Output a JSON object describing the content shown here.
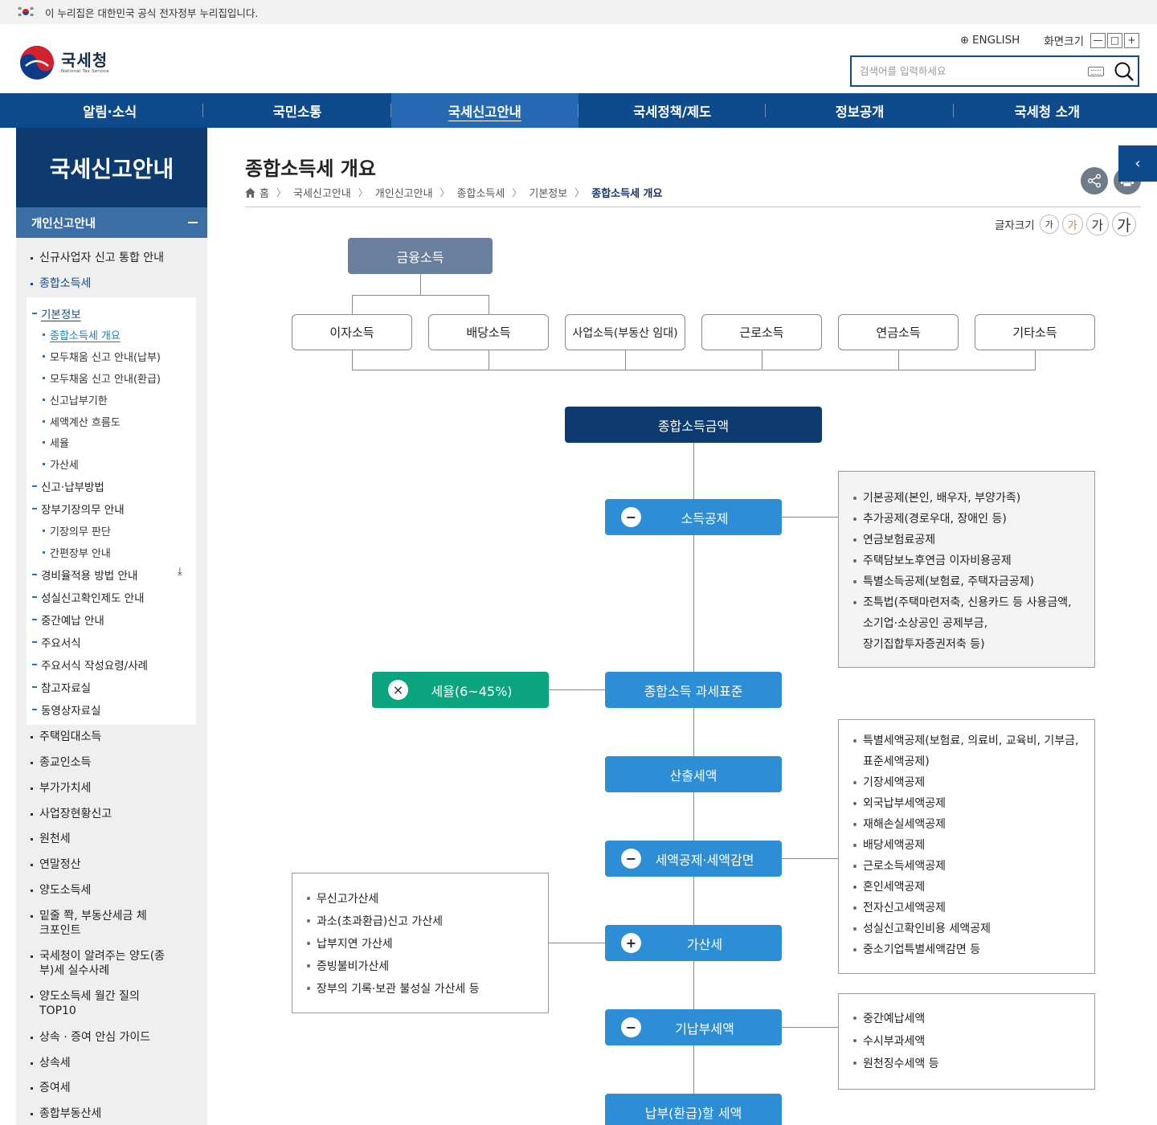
{
  "gov_banner": {
    "text": "이 누리집은 대한민국 공식 전자정부 누리집입니다."
  },
  "logo": {
    "name_kr": "국세청",
    "name_en": "National Tax Service"
  },
  "util": {
    "english": "ENGLISH",
    "screen_size": "화면크기",
    "zoom_out": "—",
    "zoom_reset": "□",
    "zoom_in": "+"
  },
  "search": {
    "placeholder": "검색어를 입력하세요"
  },
  "gnb": [
    {
      "label": "알림·소식"
    },
    {
      "label": "국민소통"
    },
    {
      "label": "국세신고안내"
    },
    {
      "label": "국세정책/제도"
    },
    {
      "label": "정보공개"
    },
    {
      "label": "국세청 소개"
    }
  ],
  "lnb": {
    "title": "국세신고안내",
    "section": "개인신고안내",
    "top_items": [
      "신규사업자 신고 통합 안내",
      "종합소득세"
    ],
    "sub_items": [
      {
        "label": "기본정보",
        "level": 2
      },
      {
        "label": "종합소득세 개요",
        "level": 3
      },
      {
        "label": "모두채움 신고 안내(납부)",
        "level": 3
      },
      {
        "label": "모두채움 신고 안내(환급)",
        "level": 3
      },
      {
        "label": "신고납부기한",
        "level": 3
      },
      {
        "label": "세액계산 흐름도",
        "level": 3
      },
      {
        "label": "세율",
        "level": 3
      },
      {
        "label": "가산세",
        "level": 3
      },
      {
        "label": "신고·납부방법",
        "level": 2
      },
      {
        "label": "장부기장의무 안내",
        "level": 2
      },
      {
        "label": "기장의무 판단",
        "level": 3
      },
      {
        "label": "간편장부 안내",
        "level": 3
      },
      {
        "label": "경비율적용 방법 안내",
        "level": 2
      },
      {
        "label": "성실신고확인제도 안내",
        "level": 2
      },
      {
        "label": "중간예납 안내",
        "level": 2
      },
      {
        "label": "주요서식",
        "level": 2
      },
      {
        "label": "주요서식 작성요령/사례",
        "level": 2
      },
      {
        "label": "참고자료실",
        "level": 2
      },
      {
        "label": "동영상자료실",
        "level": 2
      }
    ],
    "bottom_items": [
      "주택임대소득",
      "종교인소득",
      "부가가치세",
      "사업장현황신고",
      "원천세",
      "연말정산",
      "양도소득세",
      "밑줄 쫙, 부동산세금 체크포인트",
      "국세청이 알려주는 양도(종부)세 실수사례",
      "양도소득세 월간 질의 TOP10",
      "상속 · 증여 안심 가이드",
      "상속세",
      "증여세",
      "종합부동산세"
    ]
  },
  "content": {
    "title": "종합소득세 개요",
    "breadcrumb": [
      "홈",
      "국세신고안내",
      "개인신고안내",
      "종합소득세",
      "기본정보",
      "종합소득세 개요"
    ],
    "font_size_label": "글자크기",
    "font_size_glyph": "가"
  },
  "flow": {
    "source": "금융소득",
    "incomes": [
      "이자소득",
      "배당소득",
      "사업소득(부동산 임대)",
      "근로소득",
      "연금소득",
      "기타소득"
    ],
    "total": "종합소득금액",
    "steps": {
      "deduction": "소득공제",
      "tax_base": "종합소득 과세표준",
      "calc_tax": "산출세액",
      "credit": "세액공제·세액감면",
      "penalty": "가산세",
      "prepaid": "기납부세액",
      "final": "납부(환급)할 세액"
    },
    "rate": "세율(6~45%)",
    "deduction_list": [
      "기본공제(본인, 배우자, 부양가족)",
      "추가공제(경로우대, 장애인 등)",
      "연금보험료공제",
      "주택담보노후연금 이자비용공제",
      "특별소득공제(보험료, 주택자금공제)",
      "조특법(주택마련저축, 신용카드 등 사용금액,",
      "소기업·소상공인 공제부금,",
      "장기집합투자증권저축 등)"
    ],
    "credit_list": [
      "특별세액공제(보험료, 의료비, 교육비, 기부금,",
      "표준세액공제)",
      "기장세액공제",
      "외국납부세액공제",
      "재해손실세액공제",
      "배당세액공제",
      "근로소득세액공제",
      "혼인세액공제",
      "전자신고세액공제",
      "성실신고확인비용 세액공제",
      "중소기업특별세액감면 등"
    ],
    "penalty_list": [
      "무신고가산세",
      "과소(초과환급)신고 가산세",
      "납부지연 가산세",
      "증빙불비가산세",
      "장부의 기록·보관 불성실 가산세 등"
    ],
    "prepaid_list": [
      "중간예납세액",
      "수시부과세액",
      "원천징수세액 등"
    ]
  },
  "colors": {
    "navy": "#0d3b70",
    "gnb": "#0e4a8c",
    "step_blue": "#2d8ed6",
    "rate_green": "#0aa57f",
    "source_gray": "#6a7e9e"
  }
}
